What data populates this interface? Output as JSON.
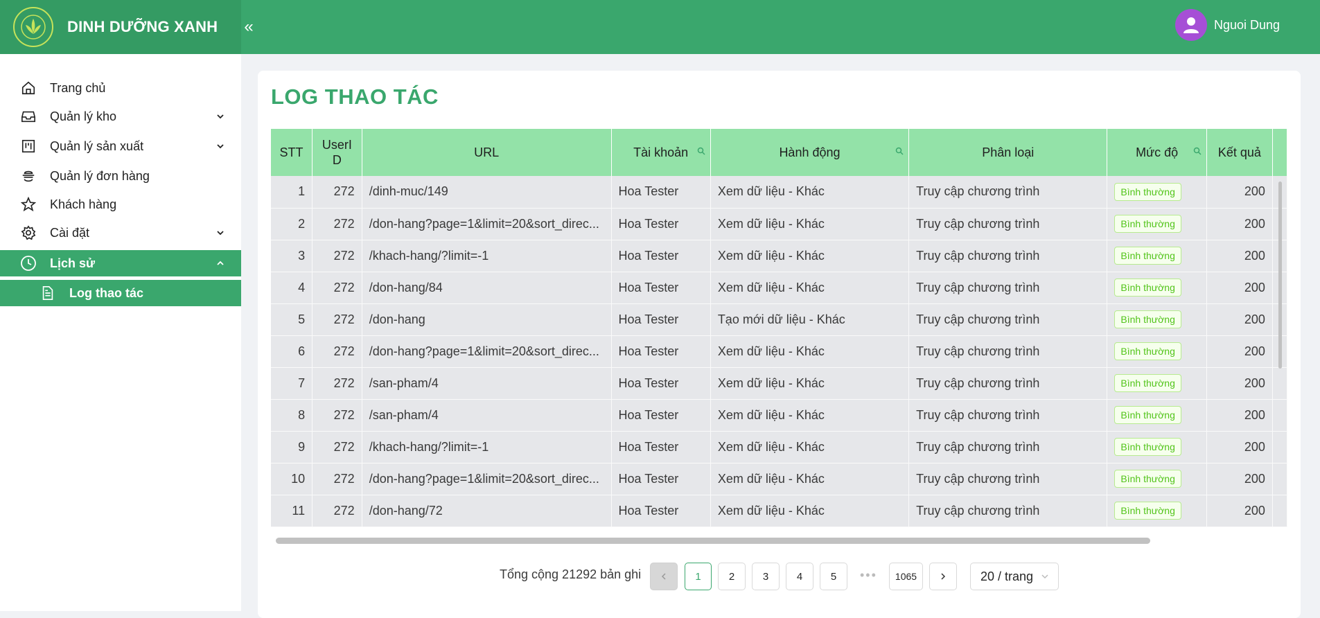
{
  "header": {
    "brand": "DINH DƯỠNG XANH",
    "collapse_glyph": "«",
    "user_name": "Nguoi Dung",
    "brand_color": "#3aa76d"
  },
  "sidebar": {
    "items": [
      {
        "label": "Trang chủ",
        "icon": "home-icon"
      },
      {
        "label": "Quản lý kho",
        "icon": "inbox-icon",
        "expandable": true
      },
      {
        "label": "Quản lý sản xuất",
        "icon": "project-icon",
        "expandable": true
      },
      {
        "label": "Quản lý đơn hàng",
        "icon": "shipping-icon"
      },
      {
        "label": "Khách hàng",
        "icon": "star-icon"
      },
      {
        "label": "Cài đặt",
        "icon": "gear-icon",
        "expandable": true
      },
      {
        "label": "Lịch sử",
        "icon": "clock-icon",
        "expandable": true,
        "active": true
      },
      {
        "label": "Log thao tác",
        "icon": "file-text-icon",
        "active": true,
        "sub": true
      }
    ]
  },
  "main": {
    "title": "LOG THAO TÁC",
    "columns": [
      "STT",
      "UserID",
      "URL",
      "Tài khoản",
      "Hành động",
      "Phân loại",
      "Mức độ",
      "Kết quả"
    ],
    "rows": [
      {
        "stt": "1",
        "user": "272",
        "url": "/dinh-muc/149",
        "acc": "Hoa Tester",
        "action": "Xem dữ liệu - Khác",
        "type": "Truy cập chương trình",
        "level": "Bình thường",
        "result": "200"
      },
      {
        "stt": "2",
        "user": "272",
        "url": "/don-hang?page=1&limit=20&sort_direc...",
        "acc": "Hoa Tester",
        "action": "Xem dữ liệu - Khác",
        "type": "Truy cập chương trình",
        "level": "Bình thường",
        "result": "200"
      },
      {
        "stt": "3",
        "user": "272",
        "url": "/khach-hang/?limit=-1",
        "acc": "Hoa Tester",
        "action": "Xem dữ liệu - Khác",
        "type": "Truy cập chương trình",
        "level": "Bình thường",
        "result": "200"
      },
      {
        "stt": "4",
        "user": "272",
        "url": "/don-hang/84",
        "acc": "Hoa Tester",
        "action": "Xem dữ liệu - Khác",
        "type": "Truy cập chương trình",
        "level": "Bình thường",
        "result": "200"
      },
      {
        "stt": "5",
        "user": "272",
        "url": "/don-hang",
        "acc": "Hoa Tester",
        "action": "Tạo mới dữ liệu - Khác",
        "type": "Truy cập chương trình",
        "level": "Bình thường",
        "result": "200"
      },
      {
        "stt": "6",
        "user": "272",
        "url": "/don-hang?page=1&limit=20&sort_direc...",
        "acc": "Hoa Tester",
        "action": "Xem dữ liệu - Khác",
        "type": "Truy cập chương trình",
        "level": "Bình thường",
        "result": "200"
      },
      {
        "stt": "7",
        "user": "272",
        "url": "/san-pham/4",
        "acc": "Hoa Tester",
        "action": "Xem dữ liệu - Khác",
        "type": "Truy cập chương trình",
        "level": "Bình thường",
        "result": "200"
      },
      {
        "stt": "8",
        "user": "272",
        "url": "/san-pham/4",
        "acc": "Hoa Tester",
        "action": "Xem dữ liệu - Khác",
        "type": "Truy cập chương trình",
        "level": "Bình thường",
        "result": "200"
      },
      {
        "stt": "9",
        "user": "272",
        "url": "/khach-hang/?limit=-1",
        "acc": "Hoa Tester",
        "action": "Xem dữ liệu - Khác",
        "type": "Truy cập chương trình",
        "level": "Bình thường",
        "result": "200"
      },
      {
        "stt": "10",
        "user": "272",
        "url": "/don-hang?page=1&limit=20&sort_direc...",
        "acc": "Hoa Tester",
        "action": "Xem dữ liệu - Khác",
        "type": "Truy cập chương trình",
        "level": "Bình thường",
        "result": "200"
      },
      {
        "stt": "11",
        "user": "272",
        "url": "/don-hang/72",
        "acc": "Hoa Tester",
        "action": "Xem dữ liệu - Khác",
        "type": "Truy cập chương trình",
        "level": "Bình thường",
        "result": "200"
      }
    ]
  },
  "pagination": {
    "total_text": "Tổng cộng 21292 bản ghi",
    "prev": "<",
    "next": ">",
    "pages": [
      "1",
      "2",
      "3",
      "4",
      "5"
    ],
    "ellipsis": "•••",
    "last_page": "1065",
    "current": "1",
    "page_size": "20 / trang"
  }
}
